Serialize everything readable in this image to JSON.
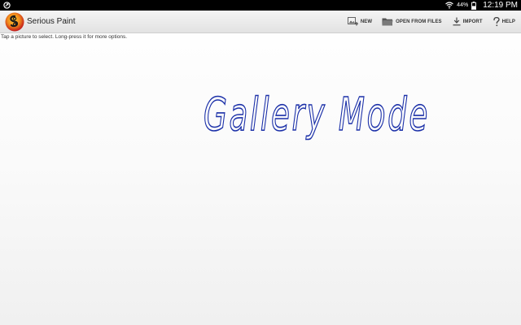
{
  "status_bar": {
    "battery_percent": "44%",
    "time": "12:19 PM",
    "icons": [
      "app-notification-icon",
      "wifi-icon",
      "battery-icon"
    ]
  },
  "action_bar": {
    "title": "Serious Paint",
    "actions": [
      {
        "label": "NEW",
        "icon": "new-image-icon"
      },
      {
        "label": "OPEN FROM FILES",
        "icon": "folder-icon"
      },
      {
        "label": "IMPORT",
        "icon": "download-icon"
      },
      {
        "label": "HELP",
        "icon": "help-icon"
      }
    ]
  },
  "gallery": {
    "hint": "Tap a picture to select. Long-press it for more options.",
    "heading": "Gallery Mode",
    "heading_color": "#1a2fa8"
  }
}
